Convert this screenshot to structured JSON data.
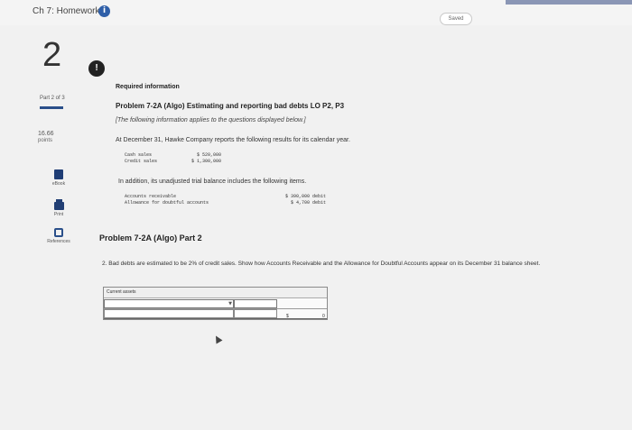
{
  "header": {
    "title": "Ch 7: Homework",
    "info_icon": "i",
    "saved_label": "Saved",
    "progress_fraction": 1.0
  },
  "sidebar": {
    "question_number": "2",
    "alert_icon": "!",
    "part_label": "Part 2 of 3",
    "points_value": "16.66",
    "points_label": "points",
    "tools": [
      {
        "icon": "ebook-icon",
        "label": "eBook"
      },
      {
        "icon": "print-icon",
        "label": "Print"
      },
      {
        "icon": "references-icon",
        "label": "References"
      }
    ]
  },
  "main": {
    "required_info": "Required information",
    "problem_title": "Problem 7-2A (Algo) Estimating and reporting bad debts LO P2, P3",
    "note": "[The following information applies to the questions displayed below.]",
    "statement": "At December 31, Hawke Company reports the following results for its calendar year.",
    "results": {
      "cash_sales_label": "Cash sales",
      "cash_sales_value": "$ 520,000",
      "credit_sales_label": "Credit sales",
      "credit_sales_value": "$ 1,300,000"
    },
    "addition_text": "In addition, its unadjusted trial balance includes the following items.",
    "trial_balance": {
      "ar_label": "Accounts receivable",
      "ar_value": "$ 390,000 debit",
      "allowance_label": "Allowance for doubtful accounts",
      "allowance_value": "$ 4,700 debit"
    },
    "part2_title": "Problem 7-2A (Algo) Part 2",
    "question_text": "2. Bad debts are estimated to be 2% of credit sales. Show how Accounts Receivable and the Allowance for Doubtful Accounts appear on its December 31 balance sheet.",
    "answer_table": {
      "header": "Current assets",
      "dropdown_icon": "chevron-down-icon",
      "dollar_sign": "$",
      "total_value": "0"
    }
  }
}
